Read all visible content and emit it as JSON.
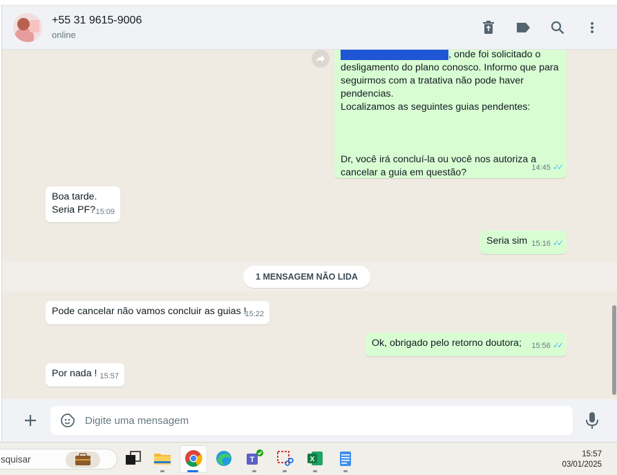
{
  "header": {
    "contact_name": "+55 31 9615-9006",
    "status": "online",
    "icons": [
      "trash-icon",
      "label-icon",
      "search-icon",
      "menu-dots-icon"
    ]
  },
  "messages": [
    {
      "direction": "out",
      "lines": [
        "desligamento do plano conosco. Informo que para",
        "seguirmos com a tratativa não pode haver",
        "pendencias.",
        "Localizamos as seguintes guias pendentes:",
        "",
        "",
        "",
        "Dr, você irá concluí-la ou você nos autoriza a",
        "cancelar a guia em questão?"
      ],
      "top_fragment": ", onde foi solicitado o",
      "time": "14:45"
    },
    {
      "direction": "in",
      "lines": [
        "Boa tarde.",
        "Seria PF?"
      ],
      "time": "15:09"
    },
    {
      "direction": "out",
      "lines": [
        "Seria sim"
      ],
      "time": "15:16"
    },
    {
      "direction": "in",
      "lines": [
        "Pode cancelar não vamos concluir as guias !"
      ],
      "time": "15:22"
    },
    {
      "direction": "out",
      "lines": [
        "Ok, obrigado pelo retorno doutora;"
      ],
      "time": "15:56"
    },
    {
      "direction": "in",
      "lines": [
        "Por nada !"
      ],
      "time": "15:57"
    }
  ],
  "unread_divider": "1 MENSAGEM NÃO LIDA",
  "composer": {
    "placeholder": "Digite uma mensagem"
  },
  "taskbar": {
    "search_text": "squisar",
    "time": "15:57",
    "date": "03/01/2025"
  },
  "colors": {
    "outgoing_bubble": "#d9fdd3",
    "incoming_bubble": "#ffffff",
    "chat_background": "#efeae2",
    "read_ticks": "#53bdeb"
  }
}
